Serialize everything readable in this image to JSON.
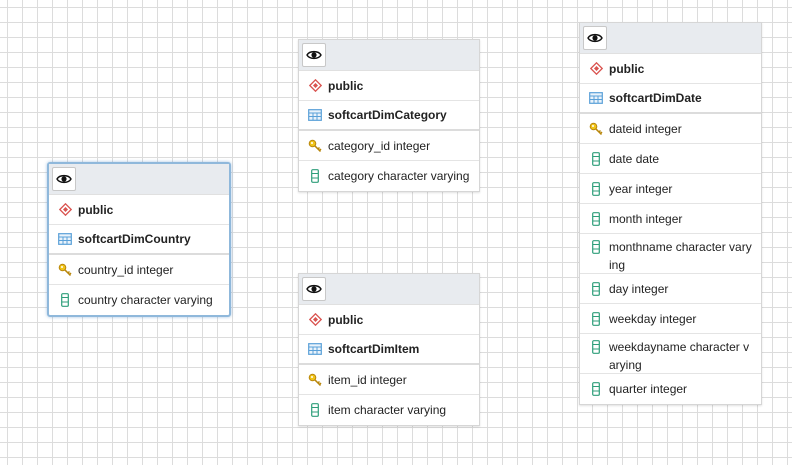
{
  "tables": [
    {
      "schema": "public",
      "name": "softcartDimCountry",
      "columns": [
        {
          "text": "country_id integer",
          "icon": "key-icon"
        },
        {
          "text": "country character varying",
          "icon": "column-icon"
        }
      ]
    },
    {
      "schema": "public",
      "name": "softcartDimCategory",
      "columns": [
        {
          "text": "category_id integer",
          "icon": "key-icon"
        },
        {
          "text": "category character varying",
          "icon": "column-icon"
        }
      ]
    },
    {
      "schema": "public",
      "name": "softcartDimItem",
      "columns": [
        {
          "text": "item_id integer",
          "icon": "key-icon"
        },
        {
          "text": "item character varying",
          "icon": "column-icon"
        }
      ]
    },
    {
      "schema": "public",
      "name": "softcartDimDate",
      "columns": [
        {
          "text": "dateid integer",
          "icon": "key-icon"
        },
        {
          "text": "date date",
          "icon": "column-icon"
        },
        {
          "text": "year integer",
          "icon": "column-icon"
        },
        {
          "text": "month integer",
          "icon": "column-icon"
        },
        {
          "text": "monthname character varying",
          "icon": "column-icon"
        },
        {
          "text": "day integer",
          "icon": "column-icon"
        },
        {
          "text": "weekday integer",
          "icon": "column-icon"
        },
        {
          "text": "weekdayname character varying",
          "icon": "column-icon"
        },
        {
          "text": "quarter integer",
          "icon": "column-icon"
        }
      ]
    }
  ],
  "colors": {
    "schema_icon": "#d9534f",
    "table_icon": "#5aa0d8",
    "key_icon": "#d4a017",
    "column_icon": "#2e9e7a",
    "selected_border": "#8fb8db"
  }
}
